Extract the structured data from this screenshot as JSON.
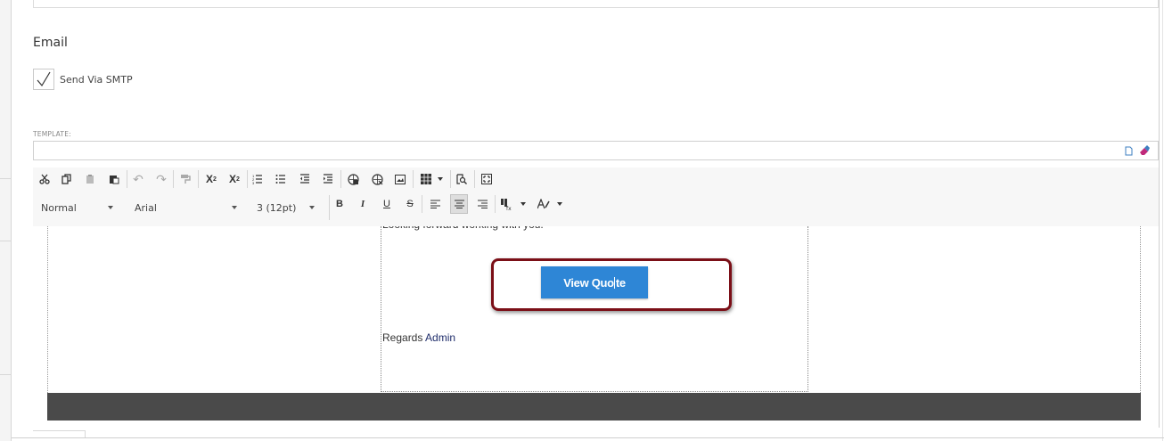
{
  "email_section": {
    "title": "Email",
    "send_via_smtp_label": "Send Via SMTP",
    "send_via_smtp_checked": true
  },
  "template": {
    "label": "TEMPLATE:",
    "value": "",
    "icons": [
      "copy-icon",
      "eraser-icon"
    ]
  },
  "toolbar": {
    "row1_icons": [
      "cut-icon",
      "copy-icon",
      "paste-icon",
      "paste-from-word-icon",
      "undo-icon",
      "redo-icon",
      "format-painter-icon",
      "superscript-icon",
      "subscript-icon",
      "ordered-list-icon",
      "unordered-list-icon",
      "outdent-icon",
      "indent-icon",
      "insert-link-icon",
      "remove-link-icon",
      "insert-image-icon",
      "insert-table-icon",
      "find-replace-icon",
      "fullscreen-icon"
    ],
    "superscript_label": "X",
    "subscript_label": "X",
    "format_block": "Normal",
    "font_name": "Arial",
    "font_size": "3 (12pt)",
    "bold_label": "B",
    "italic_label": "I",
    "underline_label": "U",
    "strike_label": "S",
    "active_align": "center",
    "accent_color": "#2e86d6",
    "highlight_color": "#7b0f17"
  },
  "editor": {
    "intro_line": "Looking forward working with you.",
    "button_label_before_cursor": "View Quo",
    "button_label_after_cursor": "te",
    "regards_text": "Regards",
    "regards_name": "Admin"
  }
}
